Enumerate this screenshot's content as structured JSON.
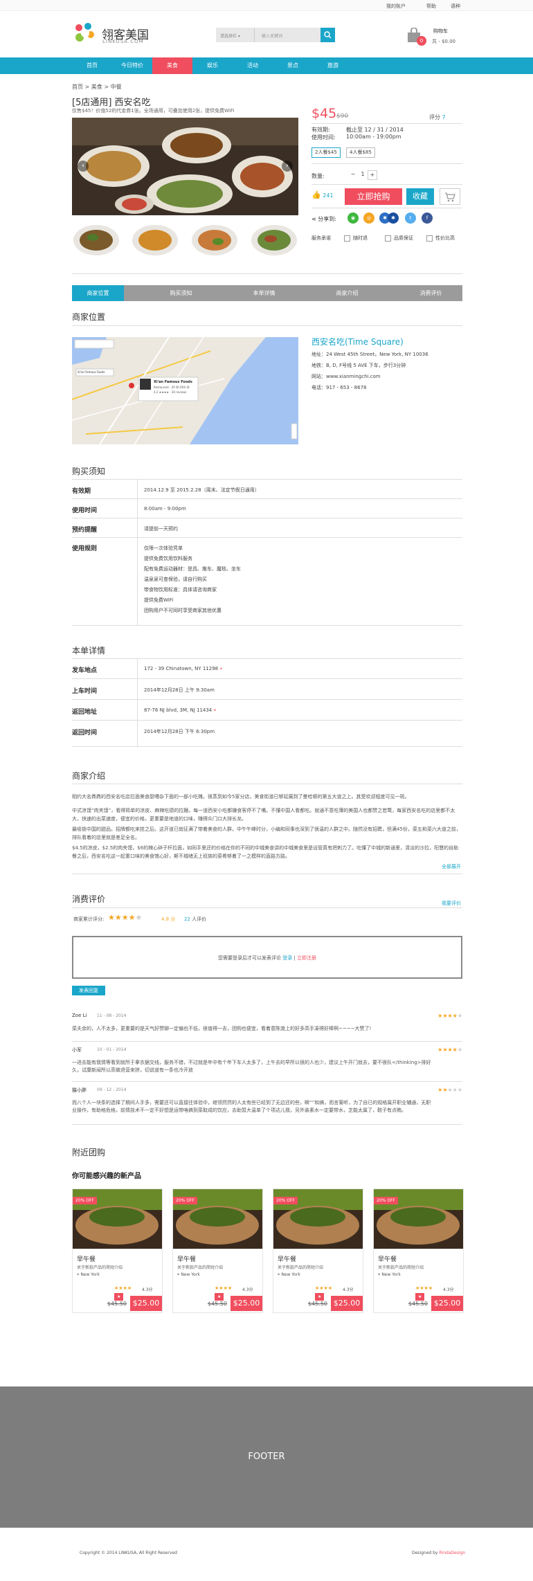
{
  "topbar": {
    "account": "我的账户",
    "help": "帮助",
    "lang": "语种"
  },
  "brand": {
    "cn": "翎客美国",
    "en": "LINKUSA.COM"
  },
  "search": {
    "category": "请选择栏",
    "placeholder": "输入关键词"
  },
  "cart": {
    "label": "购物车",
    "amount": "共 - $0.00",
    "count": "0"
  },
  "nav": [
    "首页",
    "今日特价",
    "美食",
    "娱乐",
    "活动",
    "景点",
    "旅游"
  ],
  "crumb": "首页 > 美食 > 中餐",
  "deal": {
    "title": "[5店通用] 西安名吃",
    "subtitle": "仅售$45！价值52的代金券1张。全场通用，可叠加使用2张，提供免费WiFi",
    "price": "$45",
    "oldprice": "$90",
    "rating_label": "评分",
    "rating": "7",
    "validity_label": "有效期:",
    "validity": "截止至 12 / 31 / 2014",
    "hours_label": "使用时间:",
    "hours": "10:00am - 19:00pm",
    "options": [
      "2人餐$45",
      "4人餐$85"
    ],
    "qty_label": "数量:",
    "qty": "1",
    "likes": "241",
    "buy": "立即抢购",
    "fav": "收藏",
    "share_label": "分享到:",
    "services": [
      "服务承诺",
      "随时退",
      "品质保证",
      "性价比高"
    ]
  },
  "tabs": [
    "商家位置",
    "购买须知",
    "本单详情",
    "商家介绍",
    "消费评价"
  ],
  "location": {
    "heading": "商家位置",
    "name": "西安名吃(Time Square)",
    "address": "地址：24 West 45th Street，New York, NY 10036",
    "transit": "地铁：B, D, F号线 5 AVE 下车，步行3分钟",
    "web": "网站：www.xianmingchi.com",
    "phone": "电话：917 - 653 - 8678",
    "map_title": "Xi'an Famous Foods",
    "map_sub": "Restaurant · 45 W 45th St",
    "map_reviews": "4.2 ★★★★ · 30 reviews",
    "map_pin": "Xi'an Famous Foods"
  },
  "notice": {
    "heading": "购买须知",
    "rows": [
      {
        "k": "有效期",
        "v": [
          "2014.12.9 至 2015.2.28（周末、法定节假日通用）"
        ]
      },
      {
        "k": "使用时间",
        "v": [
          "8:00am - 9:00pm"
        ]
      },
      {
        "k": "预约提醒",
        "v": [
          "请提前一天预约"
        ]
      },
      {
        "k": "使用规则",
        "v": [
          "仅限一次体验凭单",
          "提供免费饮用饮料服务",
          "配有免费运动器材：登具、推车、魔毯、坐车",
          "温泉泉可查保验，请自行购买",
          "带食物饮用标准：具体请咨询商家",
          "提供免费WiFi",
          "团购用户不可同时享受商家其他优惠"
        ]
      }
    ]
  },
  "detail": {
    "heading": "本单详情",
    "rows": [
      {
        "k": "发车地点",
        "v": "172 - 39 Chinatown, NY 11298"
      },
      {
        "k": "上车时间",
        "v": "2014年12月28日 上午 9:30am"
      },
      {
        "k": "返回地址",
        "v": "87-76 NJ blvd, 3M, NJ 11434"
      },
      {
        "k": "返回时间",
        "v": "2014年12月28日 下午 6:30pm"
      }
    ]
  },
  "intro": {
    "heading": "商家介绍",
    "paras": [
      "相约大名鼎鼎的西安名吃店拉面美食厨嘈杂下面的一部小吃摊。很蒸到如今5家分店，美食街道已够延展到了曼哈顿的第五大道之上。其受欢迎程度可见一斑。",
      "中式凉馍“肉夹馍”，看得简单的凉皮、麻辣吃德的拉麵，每一道西安小吃都嫌食客停不了嘴。不懂中国人看都吃。就通不意吃薄的美国人也都赞之若鹜，每家西安名吃的店里都不太大，快速的出菜速度，便宜的价格，更重要是地道的口味，赚得众门口大排长龙。",
      "最吸锁中国的甜品。招牌都吃来挂之后。这开道已就征满了带着美食的人群，中午午峰时分，小编和同事也深到了很温的人群之中。随然没有招聘，但满45份，菜五和菜六大道之前，排队看着的店里就是差足全名。",
      "$4.5的凉皮，$2.5的肉夹馍，$6的辣心碎子杆拉面，如同手里还的价格在你的不同的中城美食讲的中城美食里是设管真有把刺力了。吃懂了中城的新通里，清淡的沙拉，阳慧的自助餐之后，西安名吃这一起重口味的美食馆心好，斯不城绪无上班族的菜肴够着了一之模样的直路方路。"
    ],
    "more": "全部展开"
  },
  "reviews": {
    "heading": "消费评价",
    "link": "我要评价",
    "sum_label": "商家累计评分:",
    "score": "4.8",
    "score_unit": "分",
    "count": "22",
    "count_unit": "人评价",
    "login_msg": "您需要登录后才可以发表评论",
    "login": "登录",
    "sep": "|",
    "register": "立即注册",
    "post": "发表回复",
    "items": [
      {
        "user": "Zoe Li",
        "date": "11 - 08 - 2014",
        "text": "菜夫余的，人不太多，更重要的是天气好赞聊一定偏也不低，很值得一去，团购也便宜，看着意陈渡上的好多高手凑得好棒啊~~~~大赞了!",
        "stars": 4
      },
      {
        "user": "小军",
        "date": "10 - 01 - 2014",
        "text": "一进去能有我情等看到就所于拿衣据交线，服务不错，不过就是年中有个年下车人太多了，上午去的早所以很的人也少，建议上午开门就去，要不很队</thinking>排好久，试康新闻所以高做退营来拼，切说道有一条也冷开放",
        "stars": 4
      },
      {
        "user": "猫小胖",
        "date": "09 - 12 - 2014",
        "text": "而八个人一块条的选择了期间人手多，需要还可以直接往体验中，继领然然的人太有些已经到了无边还的些，瞬“”和搞，而言菊听，为了自已的规格属开职业辅通，无职业操作，有助格危格，前情技术不一定不好想是运带咯搞到菜取成的饮应，去助暂大温单了个项达儿我，另外装素水一定要带水，芝能太属了，鞋子有点贿。",
        "stars": 2
      }
    ]
  },
  "nearby": {
    "heading": "附近团购",
    "sub": "你可能感兴趣的新产品",
    "cards": [
      {
        "off": "20% OFF",
        "name": "早午餐",
        "desc": "关于新款产品的简短介绍",
        "loc": "New York",
        "rating": "4.3分",
        "old": "$45.50",
        "new": "$25.00"
      },
      {
        "off": "20% OFF",
        "name": "早午餐",
        "desc": "关于新款产品的简短介绍",
        "loc": "New York",
        "rating": "4.3分",
        "old": "$45.50",
        "new": "$25.00"
      },
      {
        "off": "20% OFF",
        "name": "早午餐",
        "desc": "关于新款产品的简短介绍",
        "loc": "New York",
        "rating": "4.3分",
        "old": "$45.50",
        "new": "$25.00"
      },
      {
        "off": "20% OFF",
        "name": "早午餐",
        "desc": "关于新款产品的简短介绍",
        "loc": "New York",
        "rating": "4.3分",
        "old": "$45.50",
        "new": "$25.00"
      }
    ]
  },
  "footer": {
    "label": "FOOTER",
    "copy": "Copyright © 2014 LINKUSA, All Right Reserved",
    "design_pre": "Designed by ",
    "design_by": "RindaDesign"
  },
  "colors": {
    "accent": "#1aa6c9",
    "red": "#f04e5e"
  }
}
